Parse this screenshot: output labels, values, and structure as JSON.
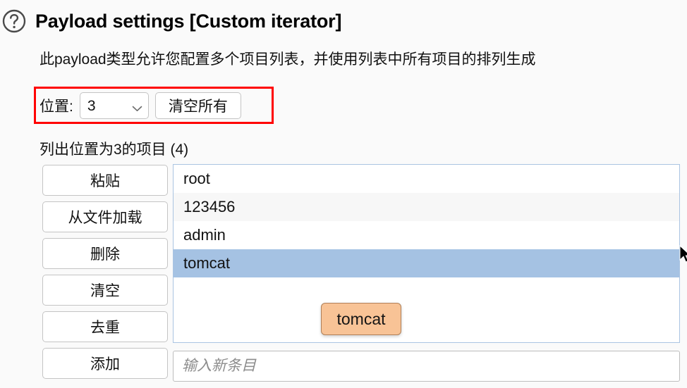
{
  "header": {
    "help_icon": "question-circle-icon",
    "title": "Payload settings [Custom iterator]",
    "description": "此payload类型允许您配置多个项目列表，并使用列表中所有项目的排列生成"
  },
  "position": {
    "label": "位置:",
    "selected_value": "3",
    "dropdown_icon": "chevron-down-icon",
    "clear_all_label": "清空所有",
    "highlight_color": "#ff0000"
  },
  "list_section": {
    "caption": "列出位置为3的项目 (4)",
    "items": [
      {
        "text": "root",
        "selected": false
      },
      {
        "text": "123456",
        "selected": false
      },
      {
        "text": "admin",
        "selected": false
      },
      {
        "text": "tomcat",
        "selected": true
      }
    ],
    "selection_color": "#a5c2e3"
  },
  "actions": {
    "buttons": [
      {
        "label": "粘贴",
        "name": "paste-button"
      },
      {
        "label": "从文件加载",
        "name": "load-from-file-button"
      },
      {
        "label": "删除",
        "name": "remove-button"
      },
      {
        "label": "清空",
        "name": "clear-button"
      },
      {
        "label": "去重",
        "name": "deduplicate-button"
      },
      {
        "label": "添加",
        "name": "add-button"
      }
    ]
  },
  "tooltip": {
    "text": "tomcat",
    "background": "#f8c396"
  },
  "new_entry": {
    "value": "",
    "placeholder": "输入新条目"
  },
  "cursor": {
    "icon": "mouse-pointer-icon"
  }
}
